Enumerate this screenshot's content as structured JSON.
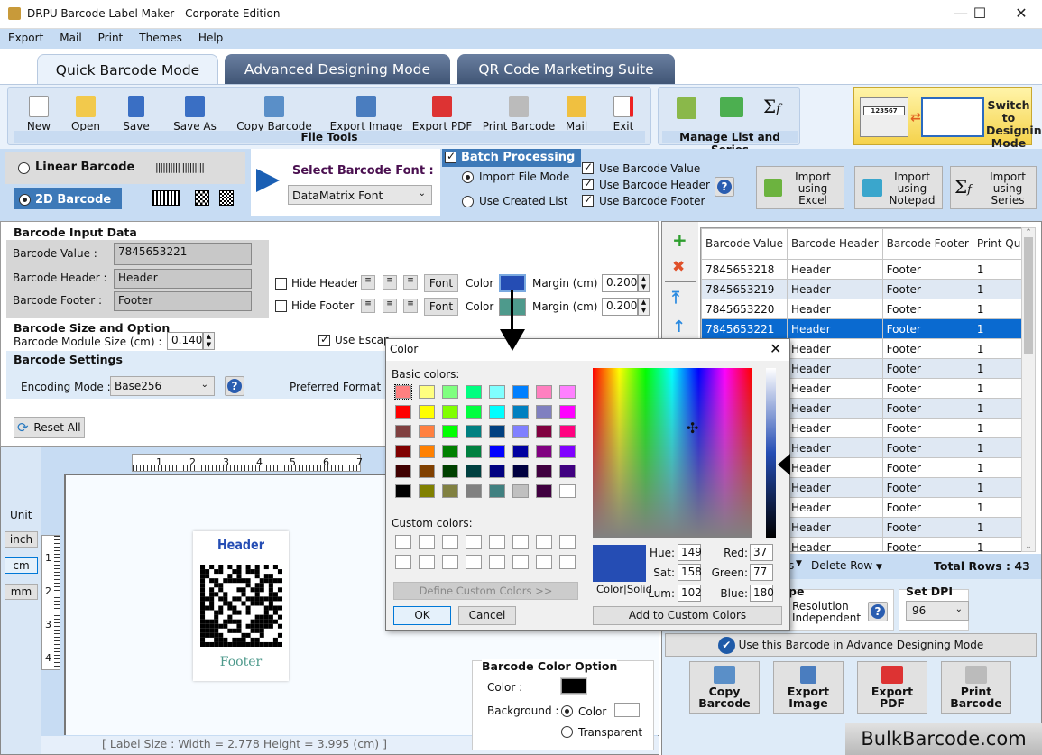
{
  "window": {
    "title": "DRPU Barcode Label Maker - Corporate Edition",
    "minimize_glyph": "—",
    "maximize_glyph": "☐",
    "close_glyph": "✕"
  },
  "menu": [
    "Export",
    "Mail",
    "Print",
    "Themes",
    "Help"
  ],
  "tabs": [
    {
      "label": "Quick Barcode Mode",
      "active": true
    },
    {
      "label": "Advanced Designing Mode",
      "active": false
    },
    {
      "label": "QR Code Marketing Suite",
      "active": false
    }
  ],
  "file_tools": {
    "group_label": "File Tools",
    "buttons": [
      {
        "label": "New",
        "icon": "new-file-icon"
      },
      {
        "label": "Open",
        "icon": "open-folder-icon"
      },
      {
        "label": "Save",
        "icon": "save-icon"
      },
      {
        "label": "Save As",
        "icon": "save-as-icon"
      },
      {
        "label": "Copy Barcode",
        "icon": "copy-barcode-icon"
      },
      {
        "label": "Export Image",
        "icon": "export-image-icon"
      },
      {
        "label": "Export PDF",
        "icon": "pdf-icon"
      },
      {
        "label": "Print Barcode",
        "icon": "printer-icon"
      },
      {
        "label": "Mail",
        "icon": "mail-icon"
      },
      {
        "label": "Exit",
        "icon": "exit-icon"
      }
    ]
  },
  "manage_list": {
    "group_label": "Manage List and Series",
    "icons": [
      "edit-list-icon",
      "excel-export-icon",
      "sigma-fx-icon"
    ]
  },
  "switch_mode": {
    "label": "Switch to Designing Mode",
    "sample_value": "123567"
  },
  "barcode_type": {
    "linear_label": "Linear Barcode",
    "twod_label": "2D Barcode",
    "selected": "2D Barcode"
  },
  "font_select": {
    "label": "Select Barcode Font :",
    "value": "DataMatrix Font"
  },
  "batch": {
    "label": "Batch Processing",
    "checked": true,
    "import_file_mode": "Import File Mode",
    "use_created_list": "Use Created List",
    "mode_selected": "Import File Mode",
    "use_value": "Use Barcode Value",
    "use_header": "Use Barcode Header",
    "use_footer": "Use Barcode Footer",
    "import_excel": "Import using Excel",
    "import_notepad": "Import using Notepad",
    "import_series": "Import using Series"
  },
  "input_data": {
    "title": "Barcode Input Data",
    "value_label": "Barcode Value :",
    "value": "7845653221",
    "header_label": "Barcode Header :",
    "header": "Header",
    "footer_label": "Barcode Footer :",
    "footer": "Footer",
    "hide_header": "Hide Header",
    "hide_footer": "Hide Footer",
    "font_label": "Font",
    "color_label": "Color",
    "margin_label": "Margin (cm)",
    "header_margin": "0.200",
    "footer_margin": "0.200",
    "header_color": "#254db4",
    "footer_color": "#4e9a8c"
  },
  "size_option": {
    "title": "Barcode Size and Option",
    "module_label": "Barcode Module Size (cm) :",
    "module_value": "0.140",
    "escape_label": "Use Escap"
  },
  "settings": {
    "title": "Barcode Settings",
    "encoding_label": "Encoding Mode :",
    "encoding_value": "Base256",
    "preferred_label": "Preferred Format :",
    "reset_label": "Reset All"
  },
  "preview": {
    "unit_label": "Unit",
    "units": [
      "inch",
      "cm",
      "mm"
    ],
    "selected_unit": "cm",
    "ruler_h": [
      "1",
      "2",
      "3",
      "4",
      "5",
      "6",
      "7"
    ],
    "ruler_v": [
      "1",
      "2",
      "3",
      "4"
    ],
    "label_header": "Header",
    "label_footer": "Footer",
    "label_size": "[ Label Size : Width = 2.778  Height = 3.995 (cm) ]"
  },
  "color_option": {
    "title": "Barcode Color Option",
    "color_label": "Color :",
    "background_label": "Background :",
    "bg_color": "Color",
    "bg_transparent": "Transparent",
    "bg_selected": "Color",
    "barcode_color": "#000000"
  },
  "table": {
    "headers": [
      "Barcode Value",
      "Barcode Header",
      "Barcode Footer",
      "Print Quantity"
    ],
    "rows": [
      [
        "7845653218",
        "Header",
        "Footer",
        "1"
      ],
      [
        "7845653219",
        "Header",
        "Footer",
        "1"
      ],
      [
        "7845653220",
        "Header",
        "Footer",
        "1"
      ],
      [
        "7845653221",
        "Header",
        "Footer",
        "1"
      ],
      [
        "",
        "Header",
        "Footer",
        "1"
      ],
      [
        "",
        "Header",
        "Footer",
        "1"
      ],
      [
        "",
        "Header",
        "Footer",
        "1"
      ],
      [
        "",
        "Header",
        "Footer",
        "1"
      ],
      [
        "",
        "Header",
        "Footer",
        "1"
      ],
      [
        "",
        "Header",
        "Footer",
        "1"
      ],
      [
        "",
        "Header",
        "Footer",
        "1"
      ],
      [
        "",
        "Header",
        "Footer",
        "1"
      ],
      [
        "",
        "Header",
        "Footer",
        "1"
      ],
      [
        "",
        "Header",
        "Footer",
        "1"
      ],
      [
        "",
        "Header",
        "Footer",
        "1"
      ]
    ],
    "selected_row": 3,
    "delete_row_label": "Delete Row",
    "partial_menu_label": "s",
    "total_rows": "Total Rows : 43"
  },
  "image_type": {
    "title_partial": "pe",
    "resolution": "Resolution Independent"
  },
  "dpi": {
    "title": "Set DPI",
    "value": "96"
  },
  "advance_btn": "Use this Barcode in Advance Designing Mode",
  "bottom_buttons": [
    "Copy Barcode",
    "Export Image",
    "Export PDF",
    "Print Barcode"
  ],
  "watermark": "BulkBarcode.com",
  "color_dialog": {
    "title": "Color",
    "basic_label": "Basic colors:",
    "custom_label": "Custom colors:",
    "define_custom": "Define Custom Colors >>",
    "ok": "OK",
    "cancel": "Cancel",
    "add_custom": "Add to Custom Colors",
    "color_solid": "Color|Solid",
    "hue_label": "Hue:",
    "hue": "149",
    "sat_label": "Sat:",
    "sat": "158",
    "lum_label": "Lum:",
    "lum": "102",
    "red_label": "Red:",
    "red": "37",
    "green_label": "Green:",
    "green": "77",
    "blue_label": "Blue:",
    "blue": "180",
    "current_color": "#254db4",
    "basic_colors": [
      "#ff8080",
      "#ffff80",
      "#80ff80",
      "#00ff80",
      "#80ffff",
      "#0080ff",
      "#ff80c0",
      "#ff80ff",
      "#ff0000",
      "#ffff00",
      "#80ff00",
      "#00ff40",
      "#00ffff",
      "#0080c0",
      "#8080c0",
      "#ff00ff",
      "#804040",
      "#ff8040",
      "#00ff00",
      "#008080",
      "#004080",
      "#8080ff",
      "#800040",
      "#ff0080",
      "#800000",
      "#ff8000",
      "#008000",
      "#008040",
      "#0000ff",
      "#0000a0",
      "#800080",
      "#8000ff",
      "#400000",
      "#804000",
      "#004000",
      "#004040",
      "#000080",
      "#000040",
      "#400040",
      "#400080",
      "#000000",
      "#808000",
      "#808040",
      "#808080",
      "#408080",
      "#c0c0c0",
      "#400040",
      "#ffffff"
    ]
  }
}
